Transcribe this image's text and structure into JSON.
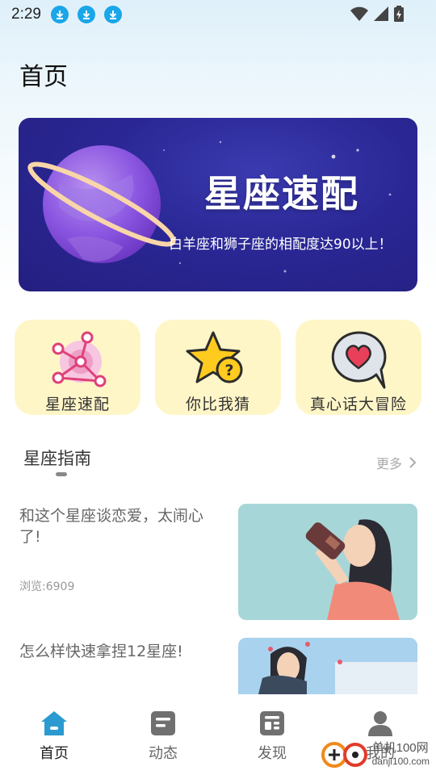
{
  "status_bar": {
    "time": "2:29",
    "notification_icons": [
      "download-icon",
      "download-icon",
      "download-icon"
    ],
    "right_icons": [
      "wifi-icon",
      "signal-icon",
      "battery-icon"
    ]
  },
  "page": {
    "title": "首页"
  },
  "banner": {
    "title": "星座速配",
    "subtitle": "白羊座和狮子座的相配度达90以上！"
  },
  "features": [
    {
      "label": "星座速配",
      "icon": "constellation-match-icon"
    },
    {
      "label": "你比我猜",
      "icon": "star-question-icon"
    },
    {
      "label": "真心话大冒险",
      "icon": "heart-bubble-icon"
    }
  ],
  "guide": {
    "title": "星座指南",
    "more": "更多"
  },
  "articles": [
    {
      "title": "和这个星座谈恋爱，太闹心了!",
      "views": "浏览:6909"
    },
    {
      "title": "怎么样快速拿捏12星座!",
      "views": ""
    }
  ],
  "tabs": [
    {
      "label": "首页",
      "icon": "home-icon",
      "active": true
    },
    {
      "label": "动态",
      "icon": "feed-icon",
      "active": false
    },
    {
      "label": "发现",
      "icon": "discover-icon",
      "active": false
    },
    {
      "label": "我的",
      "icon": "profile-icon",
      "active": false
    }
  ],
  "watermark": {
    "line1": "单机100网",
    "line2": "danji100.com"
  },
  "colors": {
    "accent": "#2b9ad0",
    "card_bg": "#fff6c8",
    "banner_bg": "#2a2795",
    "download_badge": "#1aa6e8"
  }
}
